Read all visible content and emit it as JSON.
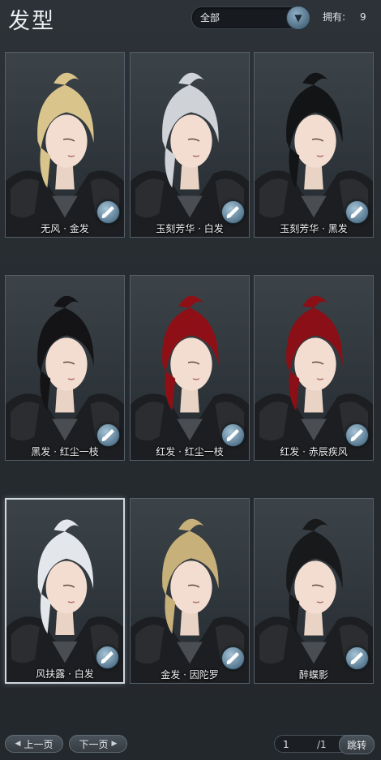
{
  "header": {
    "title": "发型",
    "filter_value": "全部",
    "owned_label": "拥有:",
    "owned_count": "9"
  },
  "hairstyles": [
    {
      "name": "无风 · 金发",
      "hair_color": "#d9c48c",
      "selected": false
    },
    {
      "name": "玉刻芳华 · 白发",
      "hair_color": "#cfd3d8",
      "selected": false
    },
    {
      "name": "玉刻芳华 · 黑发",
      "hair_color": "#131416",
      "selected": false
    },
    {
      "name": "黑发 · 红尘一枝",
      "hair_color": "#141416",
      "selected": false
    },
    {
      "name": "红发 · 红尘一枝",
      "hair_color": "#8e1016",
      "selected": false
    },
    {
      "name": "红发 · 赤辰疾风",
      "hair_color": "#8a0f16",
      "selected": false
    },
    {
      "name": "风扶露 · 白发",
      "hair_color": "#e3e6ea",
      "selected": true
    },
    {
      "name": "金发 · 因陀罗",
      "hair_color": "#c8b07a",
      "selected": false
    },
    {
      "name": "醉蝶影",
      "hair_color": "#18191b",
      "selected": false
    }
  ],
  "pager": {
    "prev_label": "上一页",
    "next_label": "下一页",
    "current_page": "1",
    "total_pages": "/1",
    "jump_label": "跳转"
  }
}
